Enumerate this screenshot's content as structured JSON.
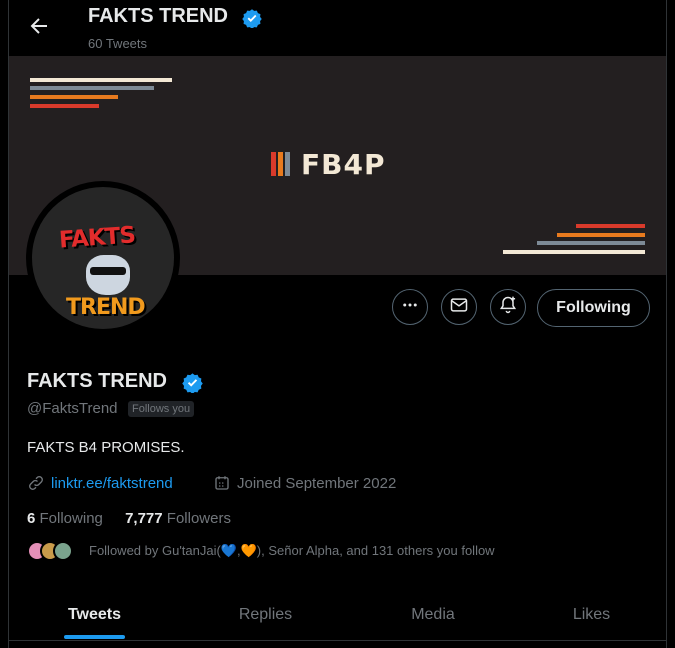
{
  "header": {
    "name": "FAKTS TREND",
    "tweet_count": "60 Tweets"
  },
  "banner": {
    "logo_text": "FB4P",
    "colors": [
      "#f3e8d5",
      "#7d8a96",
      "#e87a1e",
      "#d93a2b"
    ]
  },
  "avatar": {
    "line1": "FAKTS",
    "line2": "TREND"
  },
  "actions": {
    "more_icon": "more-horizontal-icon",
    "message_icon": "mail-icon",
    "notify_icon": "bell-plus-icon",
    "follow_label": "Following"
  },
  "profile": {
    "name": "FAKTS TREND",
    "handle": "@FaktsTrend",
    "follows_you": "Follows you",
    "bio": "FAKTS B4 PROMISES.",
    "link": "linktr.ee/faktstrend",
    "joined": "Joined September 2022",
    "following_count": "6",
    "following_label": "Following",
    "followers_count": "7,777",
    "followers_label": "Followers",
    "followed_by": "Followed by Gu'tanJai(💙,🧡), Señor Alpha, and 131 others you follow"
  },
  "tabs": [
    {
      "label": "Tweets",
      "active": true
    },
    {
      "label": "Replies",
      "active": false
    },
    {
      "label": "Media",
      "active": false
    },
    {
      "label": "Likes",
      "active": false
    }
  ],
  "colors": {
    "accent": "#1d9bf0",
    "background": "#000000"
  }
}
